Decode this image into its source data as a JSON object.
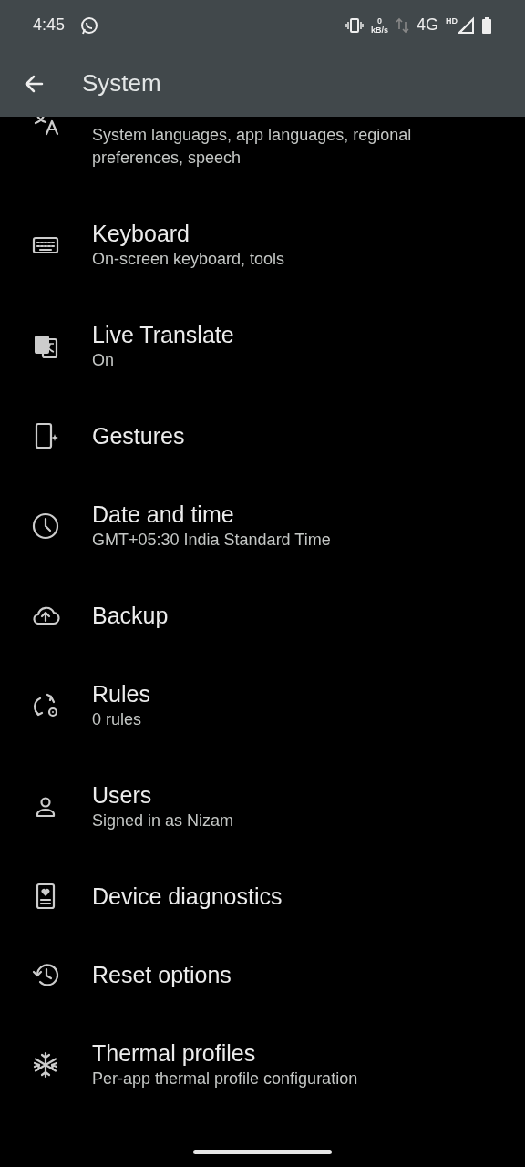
{
  "status_bar": {
    "time": "4:45",
    "speed_value": "0",
    "speed_unit": "kB/s",
    "network": "4G",
    "hd": "HD"
  },
  "app_bar": {
    "title": "System"
  },
  "items": [
    {
      "subtitle": "System languages, app languages, regional preferences, speech"
    },
    {
      "title": "Keyboard",
      "subtitle": "On-screen keyboard, tools"
    },
    {
      "title": "Live Translate",
      "subtitle": "On"
    },
    {
      "title": "Gestures"
    },
    {
      "title": "Date and time",
      "subtitle": "GMT+05:30 India Standard Time"
    },
    {
      "title": "Backup"
    },
    {
      "title": "Rules",
      "subtitle": "0 rules"
    },
    {
      "title": "Users",
      "subtitle": "Signed in as Nizam"
    },
    {
      "title": "Device diagnostics"
    },
    {
      "title": "Reset options"
    },
    {
      "title": "Thermal profiles",
      "subtitle": "Per-app thermal profile configuration"
    }
  ]
}
